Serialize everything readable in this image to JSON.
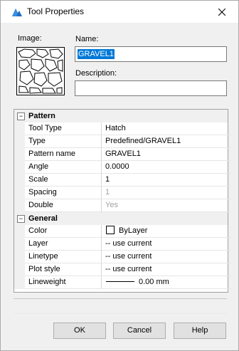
{
  "window": {
    "title": "Tool Properties",
    "app_icon": "bricscad-logo-icon",
    "close_icon": "close-icon"
  },
  "header": {
    "image_label": "Image:",
    "name_label": "Name:",
    "name_value": "GRAVEL1",
    "description_label": "Description:",
    "description_value": ""
  },
  "properties": {
    "pattern": {
      "label": "Pattern",
      "toggle": "−",
      "rows": [
        {
          "name": "Tool Type",
          "value": "Hatch"
        },
        {
          "name": "Type",
          "value": "Predefined/GRAVEL1"
        },
        {
          "name": "Pattern name",
          "value": "GRAVEL1"
        },
        {
          "name": "Angle",
          "value": "0.0000"
        },
        {
          "name": "Scale",
          "value": "1"
        },
        {
          "name": "Spacing",
          "value": "1"
        },
        {
          "name": "Double",
          "value": "Yes"
        }
      ]
    },
    "general": {
      "label": "General",
      "toggle": "−",
      "rows": [
        {
          "name": "Color",
          "value": "ByLayer"
        },
        {
          "name": "Layer",
          "value": "-- use current"
        },
        {
          "name": "Linetype",
          "value": "-- use current"
        },
        {
          "name": "Plot style",
          "value": "-- use current"
        },
        {
          "name": "Lineweight",
          "value": "0.00 mm"
        }
      ]
    }
  },
  "buttons": {
    "ok": "OK",
    "cancel": "Cancel",
    "help": "Help"
  },
  "colors": {
    "selection": "#0078d7",
    "window_bg": "#f0f0f0"
  }
}
